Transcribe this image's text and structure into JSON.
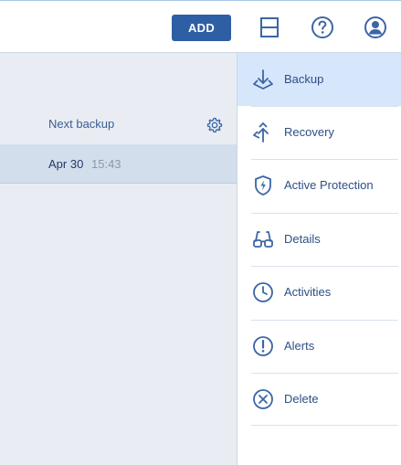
{
  "colors": {
    "accent": "#2e5ea3",
    "icon": "#3b66a6",
    "active_bg": "#d6e6fb",
    "panel_bg": "#e9edf3",
    "row_selected_bg": "#d3deec"
  },
  "toolbar": {
    "add_label": "ADD",
    "icons": [
      "layout-icon",
      "help-icon",
      "account-icon"
    ]
  },
  "plan": {
    "next_backup_label": "Next backup",
    "settings_icon": "gear-icon",
    "selected_backup": {
      "date": "Apr 30",
      "time": "15:43"
    }
  },
  "menu": {
    "items": [
      {
        "label": "Backup",
        "icon": "backup-icon",
        "active": true
      },
      {
        "label": "Recovery",
        "icon": "recovery-icon",
        "active": false
      },
      {
        "label": "Active Protection",
        "icon": "shield-icon",
        "active": false
      },
      {
        "label": "Details",
        "icon": "glasses-icon",
        "active": false
      },
      {
        "label": "Activities",
        "icon": "clock-icon",
        "active": false
      },
      {
        "label": "Alerts",
        "icon": "alert-icon",
        "active": false
      },
      {
        "label": "Delete",
        "icon": "delete-icon",
        "active": false
      }
    ]
  }
}
